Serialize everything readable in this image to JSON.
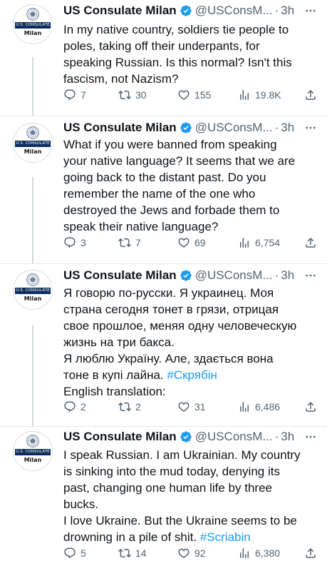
{
  "account": {
    "name": "US Consulate Milan",
    "handle": "@USConsM...",
    "separator": "·",
    "avatar_banner": "U.S. CONSULATE",
    "avatar_city": "Milan"
  },
  "colors": {
    "link": "#1d9bf0",
    "verified": "#1d9bf0",
    "secondary_text": "#536471",
    "avatar_banner": "#0d2e5c"
  },
  "tweets": [
    {
      "time": "3h",
      "text_lines": [
        "In my native country, soldiers tie people to",
        "poles, taking off their underpants, for",
        "speaking Russian. Is this normal? Isn't this",
        "fascism, not Nazism?"
      ],
      "replies": "7",
      "retweets": "30",
      "likes": "155",
      "views": "19.8K"
    },
    {
      "time": "3h",
      "text_lines": [
        "What if you were banned from speaking",
        "your native language? It seems that we are",
        "going back to the distant past. Do you",
        "remember the name of the one who",
        "destroyed the Jews and forbade them to",
        "speak their native language?"
      ],
      "replies": "3",
      "retweets": "7",
      "likes": "69",
      "views": "6,754"
    },
    {
      "time": "3h",
      "text_lines": [
        "Я говорю по-русски. Я украинец. Моя",
        "страна сегодня тонет в грязи, отрицая",
        "свое прошлое, меняя одну человеческую",
        "жизнь на три бакса.",
        "Я люблю Україну. Але, здається вона",
        "тоне в купі лайна."
      ],
      "hashtag": "#Скрябін",
      "extra_line": "English translation:",
      "replies": "2",
      "retweets": "2",
      "likes": "31",
      "views": "6,486"
    },
    {
      "time": "3h",
      "text_lines": [
        "I speak Russian. I am Ukrainian. My country",
        "is sinking into the mud today, denying its",
        "past, changing one human life by three",
        "bucks.",
        "I love Ukraine. But the Ukraine seems to be",
        "drowning in a pile of shit."
      ],
      "hashtag": "#Scriabin",
      "replies": "5",
      "retweets": "14",
      "likes": "92",
      "views": "6,380"
    }
  ],
  "icons": {
    "reply": "reply-icon",
    "retweet": "retweet-icon",
    "like": "like-icon",
    "views": "views-icon",
    "share": "share-icon",
    "verified": "verified-badge-icon",
    "more": "more-icon"
  }
}
